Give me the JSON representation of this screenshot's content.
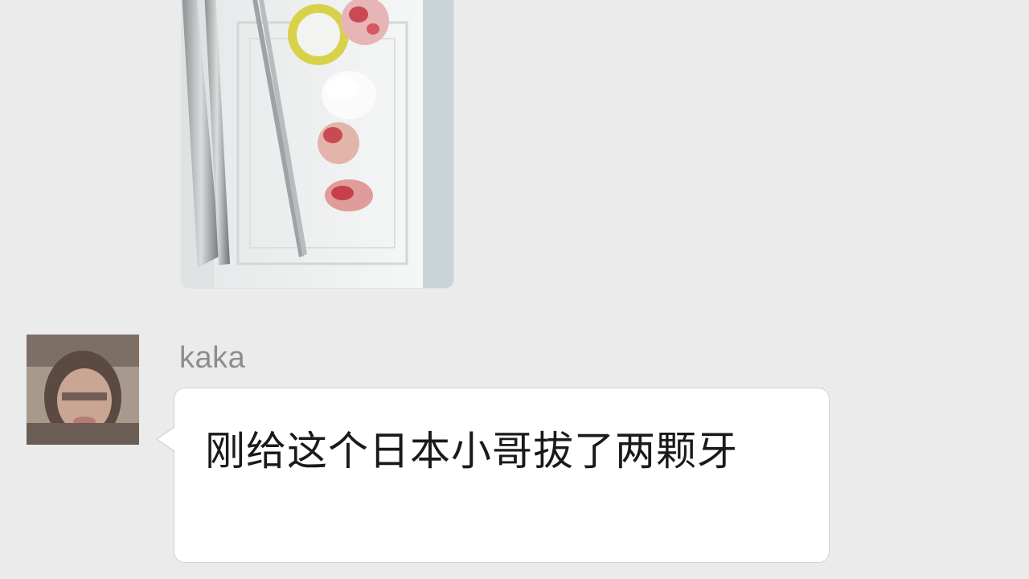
{
  "conversation": {
    "image_message": {
      "icon": "photo-thumbnail"
    },
    "message": {
      "sender": "kaka",
      "text": "刚给这个日本小哥拔了两颗牙"
    }
  },
  "colors": {
    "background": "#ebebeb",
    "bubble": "#ffffff",
    "sender_name": "#8d8d8d",
    "text": "#1a1a1a"
  }
}
